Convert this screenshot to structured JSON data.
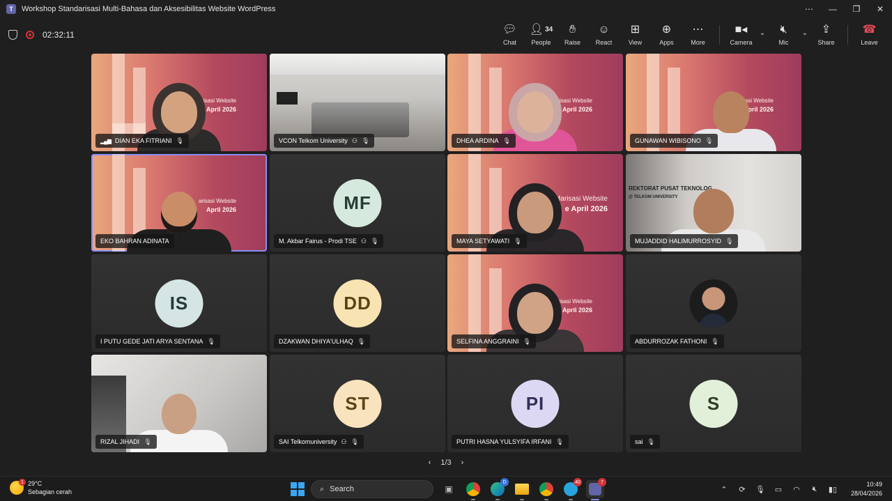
{
  "window": {
    "title": "Workshop Standarisasi Multi-Bahasa dan Aksesibilitas Website WordPress",
    "controls": [
      "⋯",
      "—",
      "❐",
      "✕"
    ]
  },
  "meeting": {
    "timer": "02:32:11"
  },
  "toolbar": {
    "chat": "Chat",
    "people": "People",
    "people_count": "34",
    "raise": "Raise",
    "react": "React",
    "view": "View",
    "apps": "Apps",
    "more": "More",
    "camera": "Camera",
    "mic": "Mic",
    "share": "Share",
    "leave": "Leave"
  },
  "slide_text": {
    "line1": "arisasi Website",
    "line2": "April 2026",
    "line2b": "e April 2026",
    "line1b": "Marisasi Website"
  },
  "office_sign": {
    "line1": "REKTORAT PUSAT TEKNOLOG",
    "line2": "@ TELKOM UNIVERSITY"
  },
  "participants": [
    {
      "name": "DIAN EKA FITRIANI"
    },
    {
      "name": "VCON Telkom University"
    },
    {
      "name": "DHEA ARDINA"
    },
    {
      "name": "GUNAWAN WIBISONO"
    },
    {
      "name": "EKO BAHRAN ADINATA"
    },
    {
      "name": "M. Akbar Fairus - Prodi TSE",
      "initials": "MF"
    },
    {
      "name": "MAYA SETYAWATI"
    },
    {
      "name": "MUJADDID HALIMURROSYID"
    },
    {
      "name": "I PUTU GEDE JATI ARYA SENTANA",
      "initials": "IS"
    },
    {
      "name": "DZAKWAN DHIYA'ULHAQ",
      "initials": "DD"
    },
    {
      "name": "SELFINA ANGGRAINI"
    },
    {
      "name": "ABDURROZAK FATHONI"
    },
    {
      "name": "RIZAL JIHADI"
    },
    {
      "name": "SAI Telkomuniversity",
      "initials": "ST"
    },
    {
      "name": "PUTRI HASNA YULSYIFA IRFANI",
      "initials": "PI"
    },
    {
      "name": "sai",
      "initials": "S"
    }
  ],
  "pager": {
    "label": "1/3"
  },
  "taskbar": {
    "weather_temp": "29°C",
    "weather_desc": "Sebagian cerah",
    "weather_badge": "1",
    "search": "Search",
    "edge_badge": "D",
    "telegram_badge": "40",
    "teams_badge": "7",
    "time": "10:49",
    "date": "28/04/2026"
  },
  "colors": {
    "accent": "#6264a7",
    "selected_outline": "#8b8cf7",
    "leave_red": "#e74856",
    "recording_red": "#d13438",
    "avatar_mf": "#d6e9df",
    "avatar_is": "#d4e5e4",
    "avatar_dd": "#f7e4b2",
    "avatar_st": "#f9e3bf",
    "avatar_pi": "#dcd8f3",
    "avatar_s": "#e3f0d9"
  }
}
